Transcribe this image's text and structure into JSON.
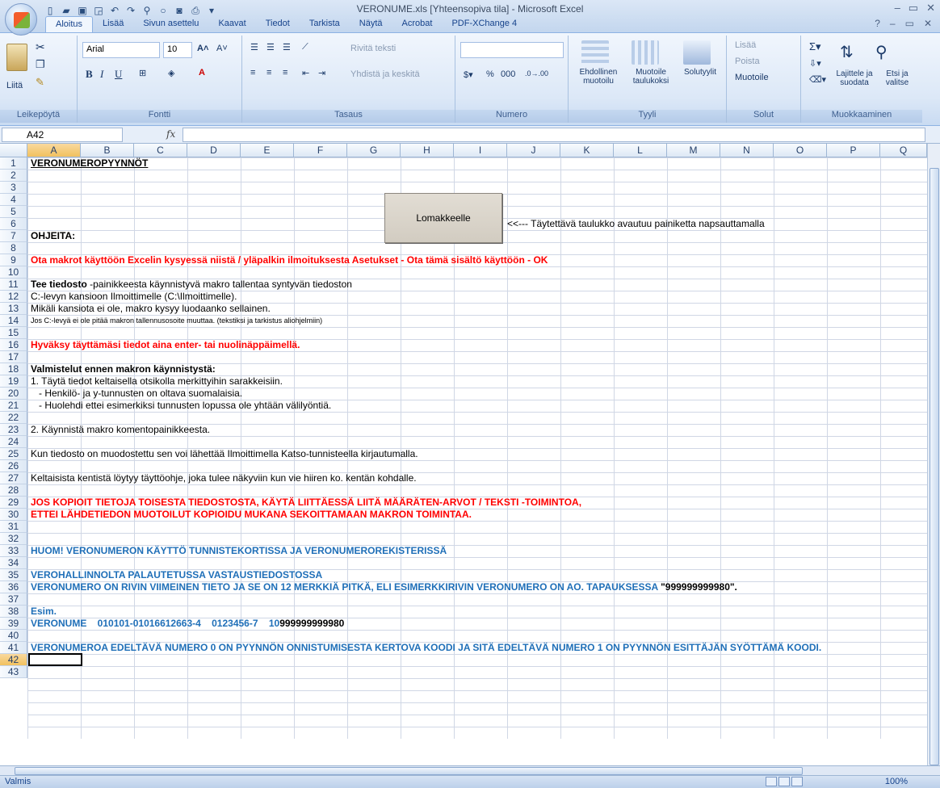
{
  "window": {
    "title": "VERONUME.xls  [Yhteensopiva tila] - Microsoft Excel",
    "controls": [
      "–",
      "▭",
      "✕"
    ]
  },
  "ribbon_tabs": [
    "Aloitus",
    "Lisää",
    "Sivun asettelu",
    "Kaavat",
    "Tiedot",
    "Tarkista",
    "Näytä",
    "Acrobat",
    "PDF-XChange 4"
  ],
  "active_tab": "Aloitus",
  "ribbon": {
    "clipboard": {
      "paste": "Liitä",
      "label": "Leikepöytä"
    },
    "font": {
      "name": "Arial",
      "size": "10",
      "bold": "B",
      "italic": "I",
      "underline": "U",
      "label": "Fontti"
    },
    "alignment": {
      "wrap": "Rivitä teksti",
      "merge": "Yhdistä ja keskitä",
      "label": "Tasaus"
    },
    "number": {
      "format": "",
      "percent": "%",
      "thousands": "000",
      "label": "Numero"
    },
    "styles": {
      "conditional": "Ehdollinen muotoilu",
      "table": "Muotoile taulukoksi",
      "cell_styles": "Solutyylit",
      "label": "Tyyli"
    },
    "cells": {
      "insert": "Lisää",
      "delete": "Poista",
      "format": "Muotoile",
      "label": "Solut"
    },
    "editing": {
      "sort": "Lajittele ja suodata",
      "find": "Etsi ja valitse",
      "label": "Muokkaaminen"
    }
  },
  "formula_bar": {
    "name_box": "A42",
    "fx": "fx",
    "value": ""
  },
  "columns": [
    "A",
    "B",
    "C",
    "D",
    "E",
    "F",
    "G",
    "H",
    "I",
    "J",
    "K",
    "L",
    "M",
    "N",
    "O",
    "P",
    "Q"
  ],
  "rows": [
    "1",
    "2",
    "3",
    "4",
    "5",
    "6",
    "7",
    "8",
    "9",
    "10",
    "11",
    "12",
    "13",
    "14",
    "15",
    "16",
    "17",
    "18",
    "19",
    "20",
    "21",
    "22",
    "23",
    "24",
    "25",
    "26",
    "27",
    "28",
    "29",
    "30",
    "31",
    "32",
    "33",
    "34",
    "35",
    "36",
    "37",
    "38",
    "39",
    "40",
    "41",
    "42",
    "43"
  ],
  "cells": {
    "r1": "VERONUMEROPYYNNÖT",
    "r6_note": "<<--- Täytettävä taulukko avautuu painiketta napsauttamalla",
    "r7": "OHJEITA:",
    "r9": "Ota makrot käyttöön Excelin kysyessä niistä / yläpalkin ilmoituksesta Asetukset - Ota tämä sisältö käyttöön - OK",
    "r11_bold": "Tee tiedosto",
    "r11_rest": " -painikkeesta käynnistyvä makro tallentaa syntyvän tiedoston",
    "r12": "C:-levyn kansioon Ilmoittimelle (C:\\Ilmoittimelle).",
    "r13": "Mikäli kansiota ei ole, makro kysyy luodaanko sellainen.",
    "r14": "Jos C:-levyä ei ole pitää makron tallennusosoite muuttaa. (tekstiksi ja tarkistus aliohjelmiin)",
    "r16": "Hyväksy täyttämäsi tiedot aina enter- tai nuolinäppäimellä.",
    "r18": "Valmistelut ennen makron käynnistystä:",
    "r19": "1. Täytä tiedot keltaisella otsikolla merkittyihin sarakkeisiin.",
    "r20": "   - Henkilö- ja y-tunnusten on oltava suomalaisia.",
    "r21": "   - Huolehdi ettei esimerkiksi tunnusten lopussa ole yhtään välilyöntiä.",
    "r23": "2. Käynnistä makro komentopainikkeesta.",
    "r25": "Kun tiedosto on muodostettu sen voi lähettää Ilmoittimella Katso-tunnisteella kirjautumalla.",
    "r27": "Keltaisista kentistä löytyy täyttöohje, joka tulee näkyviin kun vie hiiren ko. kentän kohdalle.",
    "r29": "JOS KOPIOIT TIETOJA TOISESTA TIEDOSTOSTA, KÄYTÄ LIITTÄESSÄ LIITÄ MÄÄRÄTEN-ARVOT / TEKSTI -TOIMINTOA,",
    "r30": "ETTEI LÄHDETIEDON MUOTOILUT KOPIOIDU MUKANA SEKOITTAMAAN MAKRON TOIMINTAA.",
    "r33": "HUOM! VERONUMERON KÄYTTÖ TUNNISTEKORTISSA JA VERONUMEROREKISTERISSÄ",
    "r35": "VEROHALLINNOLTA PALAUTETUSSA VASTAUSTIEDOSTOSSA",
    "r36_blue": "VERONUMERO ON RIVIN VIIMEINEN TIETO JA SE ON 12 MERKKIÄ PITKÄ, ELI ESIMERKKIRIVIN VERONUMERO ON AO. TAPAUKSESSA ",
    "r36_black": "\"999999999980\".",
    "r38": "Esim.",
    "r39_blue": "VERONUME    010101-01016612663-4    0123456-7    10",
    "r39_black": "999999999980",
    "r41": "VERONUMEROA EDELTÄVÄ NUMERO 0 ON PYYNNÖN ONNISTUMISESTA KERTOVA KOODI JA SITÄ EDELTÄVÄ NUMERO 1 ON PYYNNÖN ESITTÄJÄN SYÖTTÄMÄ KOODI."
  },
  "macro_button": "Lomakkeelle",
  "status": {
    "left": "Valmis",
    "zoom": "100%"
  },
  "colors": {
    "red": "#ff0000",
    "blue": "#1f6fb8"
  }
}
